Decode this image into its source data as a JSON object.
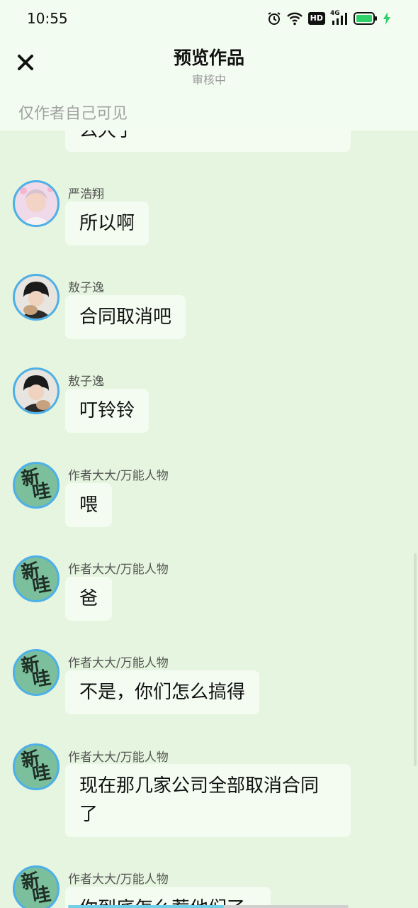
{
  "status_bar": {
    "time": "10:55",
    "icons": [
      "alarm-icon",
      "wifi-icon",
      "hd-icon",
      "signal-4g-icon",
      "battery-icon",
      "charging-icon"
    ],
    "hd_label": "HD",
    "network_label": "4G"
  },
  "header": {
    "title": "预览作品",
    "subtitle": "审核中",
    "close_icon": "close-icon",
    "notice": "仅作者自己可见"
  },
  "messages": [
    {
      "id": "m0",
      "sender": "",
      "avatar": "",
      "text": "么大了"
    },
    {
      "id": "m1",
      "sender": "严浩翔",
      "avatar": "photo-pink",
      "text": "所以啊"
    },
    {
      "id": "m2",
      "sender": "敖子逸",
      "avatar": "photo-dark",
      "text": "合同取消吧"
    },
    {
      "id": "m3",
      "sender": "敖子逸",
      "avatar": "photo-dark",
      "text": "叮铃铃"
    },
    {
      "id": "m4",
      "sender": "作者大大/万能人物",
      "avatar": "new-green",
      "text": "喂"
    },
    {
      "id": "m5",
      "sender": "作者大大/万能人物",
      "avatar": "new-green",
      "text": "爸"
    },
    {
      "id": "m6",
      "sender": "作者大大/万能人物",
      "avatar": "new-green",
      "text": "不是，你们怎么搞得"
    },
    {
      "id": "m7",
      "sender": "作者大大/万能人物",
      "avatar": "new-green",
      "text_line1": "现在那几家公司全部取消合同",
      "text_line2": "了"
    },
    {
      "id": "m8",
      "sender": "作者大大/万能人物",
      "avatar": "new-green",
      "text": "你到底怎么惹他们了"
    }
  ],
  "avatar_label": {
    "line1": "新",
    "line2": "哇"
  },
  "colors": {
    "background": "#e6f5df",
    "bubble": "#f4fcf2",
    "header": "#f3fcf1",
    "avatar_ring": "#4eb0e8",
    "battery": "#2fcf6a"
  }
}
